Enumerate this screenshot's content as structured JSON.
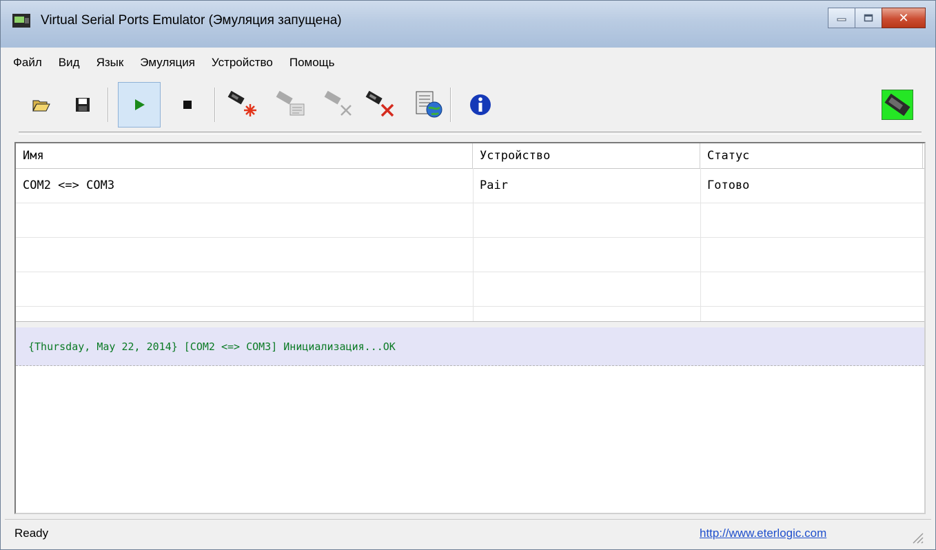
{
  "window": {
    "title": "Virtual Serial Ports Emulator (Эмуляция запущена)"
  },
  "menu": [
    "Файл",
    "Вид",
    "Язык",
    "Эмуляция",
    "Устройство",
    "Помощь"
  ],
  "toolbar": {
    "buttons": [
      {
        "name": "open-icon",
        "pressed": false
      },
      {
        "name": "save-icon",
        "pressed": false
      },
      {
        "name": "play-icon",
        "pressed": true
      },
      {
        "name": "stop-icon",
        "pressed": false
      },
      {
        "name": "create-device-icon",
        "pressed": false
      },
      {
        "name": "device-properties-icon",
        "pressed": false
      },
      {
        "name": "remove-device-icon",
        "pressed": false
      },
      {
        "name": "delete-device-icon",
        "pressed": false
      },
      {
        "name": "network-settings-icon",
        "pressed": false
      },
      {
        "name": "info-icon",
        "pressed": false
      }
    ]
  },
  "table": {
    "columns": [
      "Имя",
      "Устройство",
      "Статус"
    ],
    "rows": [
      [
        "COM2 <=> COM3",
        "Pair",
        "Готово"
      ]
    ]
  },
  "log": {
    "lines": [
      "{Thursday, May 22, 2014} [COM2 <=> COM3] Инициализация...OK"
    ]
  },
  "status": {
    "text": "Ready",
    "link": "http://www.eterlogic.com"
  },
  "colors": {
    "log_text": "#0a7a24",
    "log_bg": "#e4e4f7",
    "link": "#1f4fcc",
    "close_button": "#c8452a"
  }
}
